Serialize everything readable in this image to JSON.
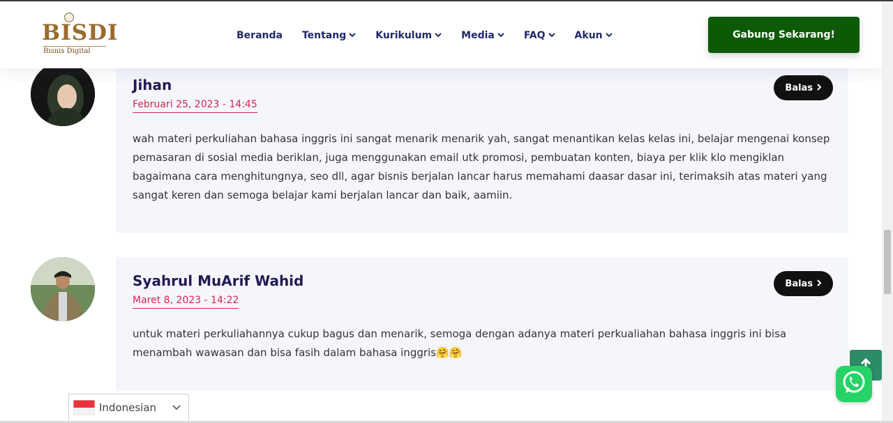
{
  "header": {
    "logo": {
      "word": "BISDI",
      "subtitle": "Bisnis Digital"
    },
    "nav": [
      {
        "label": "Beranda",
        "has_dropdown": false
      },
      {
        "label": "Tentang",
        "has_dropdown": true
      },
      {
        "label": "Kurikulum",
        "has_dropdown": true
      },
      {
        "label": "Media",
        "has_dropdown": true
      },
      {
        "label": "FAQ",
        "has_dropdown": true
      },
      {
        "label": "Akun",
        "has_dropdown": true
      }
    ],
    "cta_label": "Gabung Sekarang!"
  },
  "comments": [
    {
      "author": "Jihan",
      "date": "Februari 25, 2023 - 14:45",
      "reply_label": "Balas",
      "text": "wah materi perkuliahan bahasa inggris ini sangat menarik menarik yah, sangat menantikan kelas kelas ini, belajar mengenai konsep pemasaran di sosial media beriklan, juga menggunakan email utk promosi, pembuatan konten, biaya per klik klo mengiklan bagaimana cara menghitungnya, seo dll, agar bisnis berjalan lancar harus memahami daasar dasar ini, terimaksih atas materi yang sangat keren dan semoga belajar kami berjalan lancar dan baik, aamiin."
    },
    {
      "author": "Syahrul MuArif Wahid",
      "date": "Maret 8, 2023 - 14:22",
      "reply_label": "Balas",
      "text": "untuk materi perkuliahannya cukup bagus dan menarik, semoga dengan adanya materi perkualiahan bahasa inggris ini bisa menambah wawasan dan bisa fasih dalam bahasa inggris🤗🤗"
    }
  ],
  "language_selector": {
    "selected": "Indonesian"
  },
  "colors": {
    "nav_text": "#1e2a6b",
    "cta_bg": "#0c5a06",
    "author": "#221a55",
    "date": "#d4264f",
    "card_bg": "#f4f6fb",
    "to_top_bg": "#2e8b67",
    "whatsapp": "#25d366"
  },
  "icons": [
    "chevron-down-icon",
    "chevron-right-icon",
    "arrow-up-icon",
    "whatsapp-icon",
    "indonesia-flag-icon"
  ]
}
